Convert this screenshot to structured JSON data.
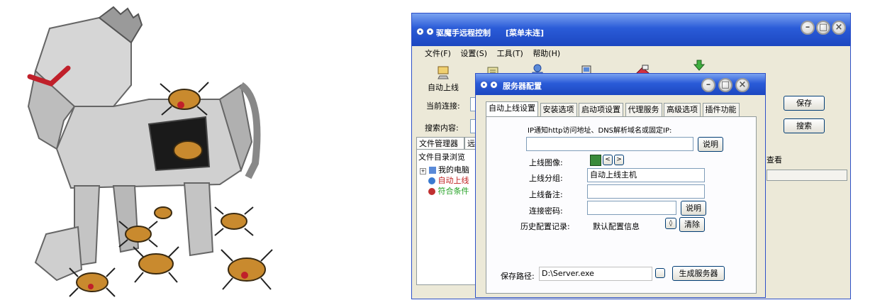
{
  "main_window": {
    "title": "驱魔手远程控制",
    "title_suffix": "[菜单未连]",
    "menu": [
      "文件(F)",
      "设置(S)",
      "工具(T)",
      "帮助(H)"
    ],
    "toolbar": [
      {
        "label": "自动上线",
        "icon": "auto-online-icon"
      }
    ],
    "connection_label": "当前连接:",
    "search_label": "搜索内容:",
    "save_button": "保存",
    "search_button": "搜索",
    "tabs": [
      "文件管理器",
      "远"
    ],
    "tree_header": "文件目录浏览",
    "tree_items": [
      "我的电脑",
      "自动上线",
      "符合条件"
    ],
    "view_label": "查看"
  },
  "dialog": {
    "title": "服务器配置",
    "tabs": [
      "自动上线设置",
      "安装选项",
      "启动项设置",
      "代理服务",
      "高级选项",
      "插件功能"
    ],
    "ip_label": "IP通知http访问地址、DNS解析域名或固定IP:",
    "ip_value": "",
    "explain_button": "说明",
    "online_icon_label": "上线图像:",
    "group_label": "上线分组:",
    "group_value": "自动上线主机",
    "note_label": "上线备注:",
    "note_value": "",
    "password_label": "连接密码:",
    "password_value": "",
    "password_explain_button": "说明",
    "history_label": "历史配置记录:",
    "history_value": "默认配置信息",
    "clear_button": "清除",
    "save_path_label": "保存路径:",
    "save_path_value": "D:\\Server.exe",
    "generate_button": "生成服务器"
  },
  "colors": {
    "titlebar_blue": "#2a5bd8",
    "window_face": "#ece9d8",
    "horse_gray": "#c9c9c9",
    "horse_red": "#c0202a",
    "bug_orange": "#c98a2e"
  }
}
